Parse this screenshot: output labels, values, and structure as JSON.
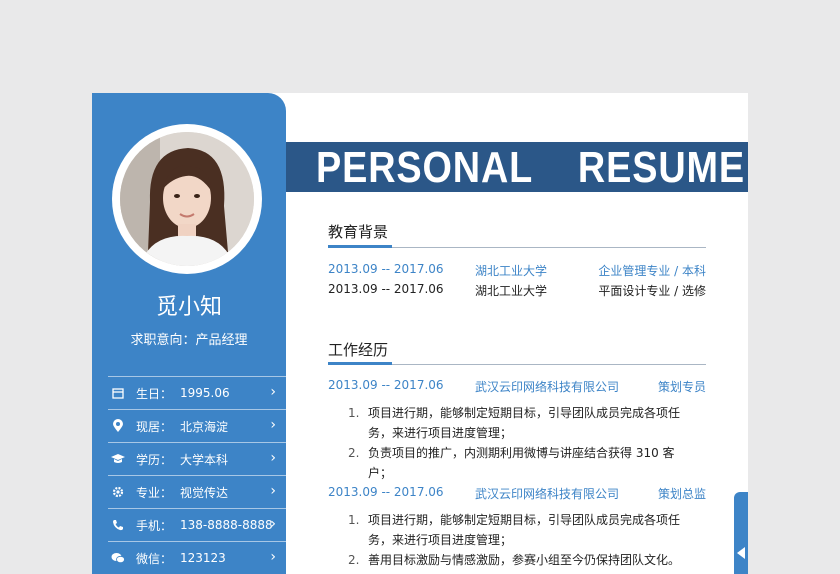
{
  "theme": {
    "accent": "#3d84c7",
    "banner": "#2b5788",
    "background": "#e9e9ea"
  },
  "profile": {
    "name": "觅小知",
    "intent": "求职意向：产品经理"
  },
  "banner": {
    "text": "PERSONAL    RESUME"
  },
  "info": [
    {
      "icon": "calendar-icon",
      "label": "生日：",
      "value": "1995.06"
    },
    {
      "icon": "location-pin-icon",
      "label": "现居：",
      "value": "北京海淀"
    },
    {
      "icon": "graduation-cap-icon",
      "label": "学历：",
      "value": "大学本科"
    },
    {
      "icon": "gear-icon",
      "label": "专业：",
      "value": "视觉传达"
    },
    {
      "icon": "phone-icon",
      "label": "手机：",
      "value": "138-8888-8888"
    },
    {
      "icon": "wechat-icon",
      "label": "微信：",
      "value": "123123"
    }
  ],
  "education": {
    "title": "教育背景",
    "rows": [
      {
        "date": "2013.09 -- 2017.06",
        "school": "湖北工业大学",
        "major": "企业管理专业 / 本科"
      },
      {
        "date": "2013.09 -- 2017.06",
        "school": "湖北工业大学",
        "major": "平面设计专业 / 选修"
      }
    ]
  },
  "work": {
    "title": "工作经历",
    "jobs": [
      {
        "date": "2013.09 -- 2017.06",
        "company": "武汉云印网络科技有限公司",
        "role": "策划专员",
        "items": [
          {
            "num": "1.",
            "line1": "项目进行期，能够制定短期目标，引导团队成员完成各项任",
            "line2": "务，来进行项目进度管理；"
          },
          {
            "num": "2.",
            "line1": "负责项目的推广，内测期利用微博与讲座结合获得 310 客户；",
            "line2": ""
          }
        ]
      },
      {
        "date": "2013.09 -- 2017.06",
        "company": "武汉云印网络科技有限公司",
        "role": "策划总监",
        "items": [
          {
            "num": "1.",
            "line1": "项目进行期，能够制定短期目标，引导团队成员完成各项任",
            "line2": "务，来进行项目进度管理；"
          },
          {
            "num": "2.",
            "line1": "善用目标激励与情感激励，参赛小组至今仍保持团队文化。",
            "line2": ""
          }
        ]
      }
    ]
  }
}
